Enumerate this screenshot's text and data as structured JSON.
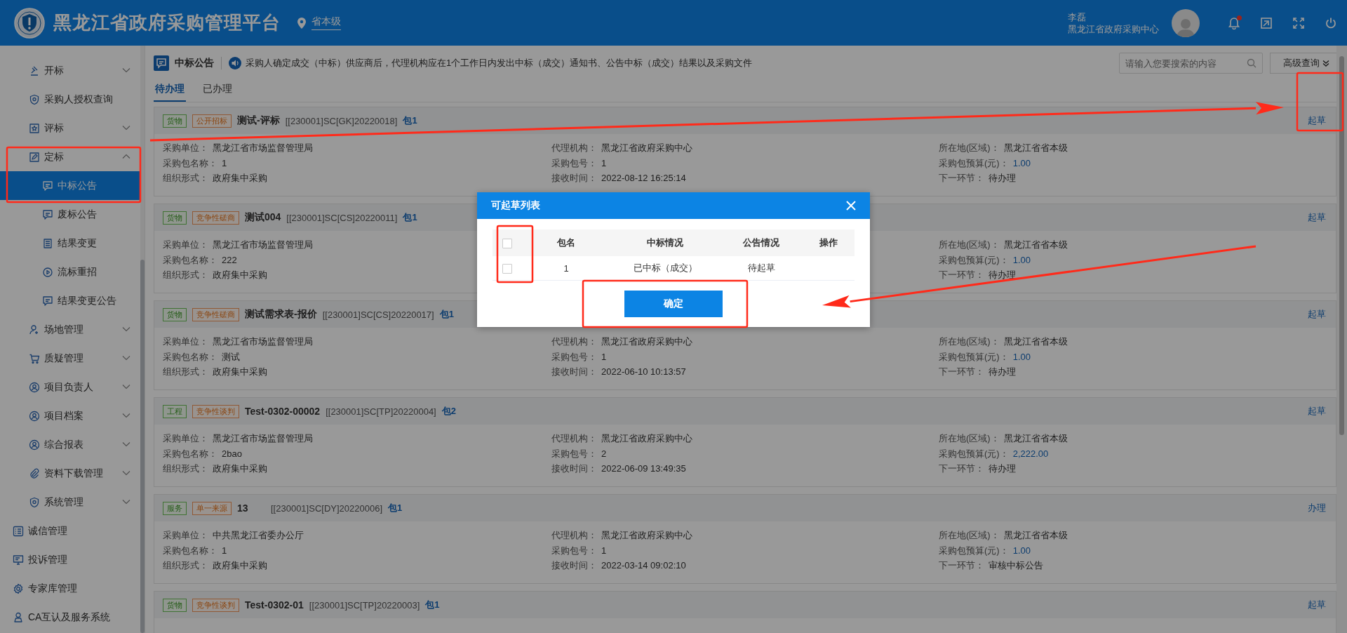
{
  "header": {
    "title": "黑龙江省政府采购管理平台",
    "region": "省本级",
    "user_name": "李磊",
    "user_org": "黑龙江省政府采购中心",
    "notification_dot": true
  },
  "sidebar": {
    "group_items": [
      {
        "label": "开标",
        "expanded": false,
        "selected": false
      },
      {
        "label": "采购人授权查询",
        "selected": false
      },
      {
        "label": "评标",
        "expanded": false,
        "selected": false
      },
      {
        "label": "定标",
        "expanded": true,
        "selected": false,
        "children": [
          {
            "label": "中标公告",
            "selected": true
          },
          {
            "label": "废标公告",
            "selected": false
          },
          {
            "label": "结果变更",
            "selected": false
          },
          {
            "label": "流标重招",
            "selected": false
          },
          {
            "label": "结果变更公告",
            "selected": false
          }
        ]
      },
      {
        "label": "场地管理",
        "expanded": false,
        "selected": false
      },
      {
        "label": "质疑管理",
        "expanded": false,
        "selected": false
      },
      {
        "label": "项目负责人",
        "expanded": false,
        "selected": false
      },
      {
        "label": "项目档案",
        "expanded": false,
        "selected": false
      },
      {
        "label": "综合报表",
        "expanded": false,
        "selected": false
      },
      {
        "label": "资料下载管理",
        "expanded": false,
        "selected": false
      },
      {
        "label": "系统管理",
        "expanded": false,
        "selected": false
      }
    ],
    "items": [
      {
        "label": "诚信管理",
        "selected": false
      },
      {
        "label": "投诉管理",
        "selected": false
      },
      {
        "label": "专家库管理",
        "selected": false
      },
      {
        "label": "CA互认及服务系统",
        "selected": false
      }
    ]
  },
  "page": {
    "title": "中标公告",
    "notice": "采购人确定成交（中标）供应商后，代理机构应在1个工作日内发出中标（成交）通知书、公告中标（成交）结果以及采购文件",
    "search": {
      "placeholder": "请输入您要搜索的内容"
    },
    "advanced_button": "高级查询",
    "tabs": [
      {
        "label": "待办理",
        "selected": true
      },
      {
        "label": "已办理",
        "selected": false
      }
    ]
  },
  "records": [
    {
      "category": "货物",
      "method": "公开招标",
      "name": "测试-评标",
      "code": "[[230001]SC[GK]20220018]",
      "package": "包1",
      "action": "起草",
      "left_fields": [
        {
          "label": "采购单位：",
          "value": "黑龙江省市场监督管理局"
        },
        {
          "label": "采购包名称：",
          "value": "1"
        },
        {
          "label": "组织形式：",
          "value": "政府集中采购"
        }
      ],
      "middle_fields": [
        {
          "label": "代理机构：",
          "value": "黑龙江省政府采购中心"
        },
        {
          "label": "采购包号：",
          "value": "1"
        },
        {
          "label": "接收时间：",
          "value": "2022-08-12 16:25:14"
        }
      ],
      "right_fields": [
        {
          "label": "所在地(区域)：",
          "value": "黑龙江省省本级"
        },
        {
          "label": "采购包预算(元)：",
          "value": "1.00",
          "kind": "amount"
        },
        {
          "label": "下一环节：",
          "value": "待办理"
        }
      ]
    },
    {
      "category": "货物",
      "method": "竞争性磋商",
      "name": "测试004",
      "code": "[[230001]SC[CS]20220011]",
      "package": "包1",
      "action": "起草",
      "left_fields": [
        {
          "label": "采购单位：",
          "value": "黑龙江省市场监督管理局"
        },
        {
          "label": "采购包名称：",
          "value": "222"
        },
        {
          "label": "组织形式：",
          "value": "政府集中采购"
        }
      ],
      "right_fields": [
        {
          "label": "所在地(区域)：",
          "value": "黑龙江省省本级"
        },
        {
          "label": "采购包预算(元)：",
          "value": "1.00",
          "kind": "amount"
        },
        {
          "label": "下一环节：",
          "value": "待办理"
        }
      ]
    },
    {
      "category": "货物",
      "method": "竞争性磋商",
      "name": "测试需求表-报价",
      "code": "[[230001]SC[CS]20220017]",
      "package": "包1",
      "action": "起草",
      "left_fields": [
        {
          "label": "采购单位：",
          "value": "黑龙江省市场监督管理局"
        },
        {
          "label": "采购包名称：",
          "value": "测试"
        },
        {
          "label": "组织形式：",
          "value": "政府集中采购"
        }
      ],
      "middle_fields": [
        {
          "label": "代理机构：",
          "value": "黑龙江省政府采购中心"
        },
        {
          "label": "采购包号：",
          "value": "1"
        },
        {
          "label": "接收时间：",
          "value": "2022-06-10 10:13:57"
        }
      ],
      "right_fields": [
        {
          "label": "所在地(区域)：",
          "value": "黑龙江省省本级"
        },
        {
          "label": "采购包预算(元)：",
          "value": "1.00",
          "kind": "amount"
        },
        {
          "label": "下一环节：",
          "value": "待办理"
        }
      ]
    },
    {
      "category": "工程",
      "method": "竞争性谈判",
      "name": "Test-0302-00002",
      "code": "[[230001]SC[TP]20220004]",
      "package": "包2",
      "action": "起草",
      "left_fields": [
        {
          "label": "采购单位：",
          "value": "黑龙江省市场监督管理局"
        },
        {
          "label": "采购包名称：",
          "value": "2bao"
        },
        {
          "label": "组织形式：",
          "value": "政府集中采购"
        }
      ],
      "middle_fields": [
        {
          "label": "代理机构：",
          "value": "黑龙江省政府采购中心"
        },
        {
          "label": "采购包号：",
          "value": "2"
        },
        {
          "label": "接收时间：",
          "value": "2022-06-09 13:49:35"
        }
      ],
      "right_fields": [
        {
          "label": "所在地(区域)：",
          "value": "黑龙江省省本级"
        },
        {
          "label": "采购包预算(元)：",
          "value": "2,222.00",
          "kind": "amount"
        },
        {
          "label": "下一环节：",
          "value": "待办理"
        }
      ]
    },
    {
      "category": "服务",
      "method": "单一来源",
      "name": "13",
      "code": "[[230001]SC[DY]20220006]",
      "package": "包1",
      "action": "办理",
      "left_fields": [
        {
          "label": "采购单位：",
          "value": "中共黑龙江省委办公厅"
        },
        {
          "label": "采购包名称：",
          "value": "1"
        },
        {
          "label": "组织形式：",
          "value": "政府集中采购"
        }
      ],
      "middle_fields": [
        {
          "label": "代理机构：",
          "value": "黑龙江省政府采购中心"
        },
        {
          "label": "采购包号：",
          "value": "1"
        },
        {
          "label": "接收时间：",
          "value": "2022-03-14 09:02:10"
        }
      ],
      "right_fields": [
        {
          "label": "所在地(区域)：",
          "value": "黑龙江省省本级"
        },
        {
          "label": "采购包预算(元)：",
          "value": "1.00",
          "kind": "amount"
        },
        {
          "label": "下一环节：",
          "value": "审核中标公告"
        }
      ]
    },
    {
      "category": "货物",
      "method": "竞争性谈判",
      "name": "Test-0302-01",
      "code": "[[230001]SC[TP]20220003]",
      "package": "包1",
      "action": "起草"
    }
  ],
  "dialog": {
    "title": "可起草列表",
    "header_checked": false,
    "columns": [
      "包名",
      "中标情况",
      "公告情况",
      "操作"
    ],
    "rows": [
      {
        "checked": false,
        "cells": [
          "1",
          "已中标（成交）",
          "待起草"
        ]
      }
    ],
    "confirm_button": "确定"
  },
  "annotations": [
    {
      "kind": "box"
    },
    {
      "kind": "box"
    },
    {
      "kind": "arrow"
    },
    {
      "kind": "box"
    },
    {
      "kind": "box"
    },
    {
      "kind": "arrow"
    }
  ]
}
